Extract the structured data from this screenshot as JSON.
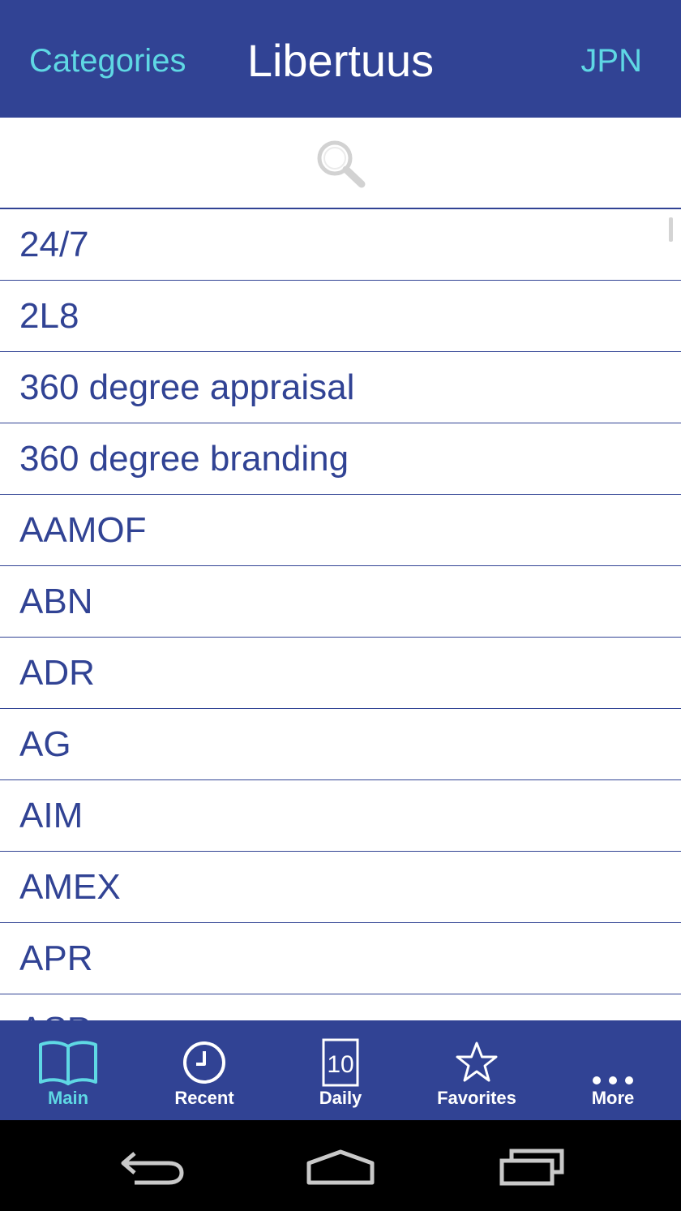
{
  "header": {
    "left_label": "Categories",
    "title": "Libertuus",
    "right_label": "JPN"
  },
  "search": {
    "icon": "search-icon"
  },
  "list": {
    "items": [
      "24/7",
      "2L8",
      "360 degree appraisal",
      "360 degree branding",
      "AAMOF",
      "ABN",
      "ADR",
      "AG",
      "AIM",
      "AMEX",
      "APR",
      "ASP"
    ]
  },
  "tabs": [
    {
      "label": "Main",
      "icon": "book-icon",
      "active": true
    },
    {
      "label": "Recent",
      "icon": "clock-icon",
      "active": false
    },
    {
      "label": "Daily",
      "icon": "calendar-10-icon",
      "active": false
    },
    {
      "label": "Favorites",
      "icon": "star-icon",
      "active": false
    },
    {
      "label": "More",
      "icon": "more-icon",
      "active": false
    }
  ],
  "daily_icon_number": "10",
  "system_nav": {
    "back": "back-icon",
    "home": "home-icon",
    "recents": "recent-apps-icon"
  },
  "colors": {
    "brand": "#314394",
    "accent": "#5fd8e4",
    "list_text": "#314394"
  }
}
